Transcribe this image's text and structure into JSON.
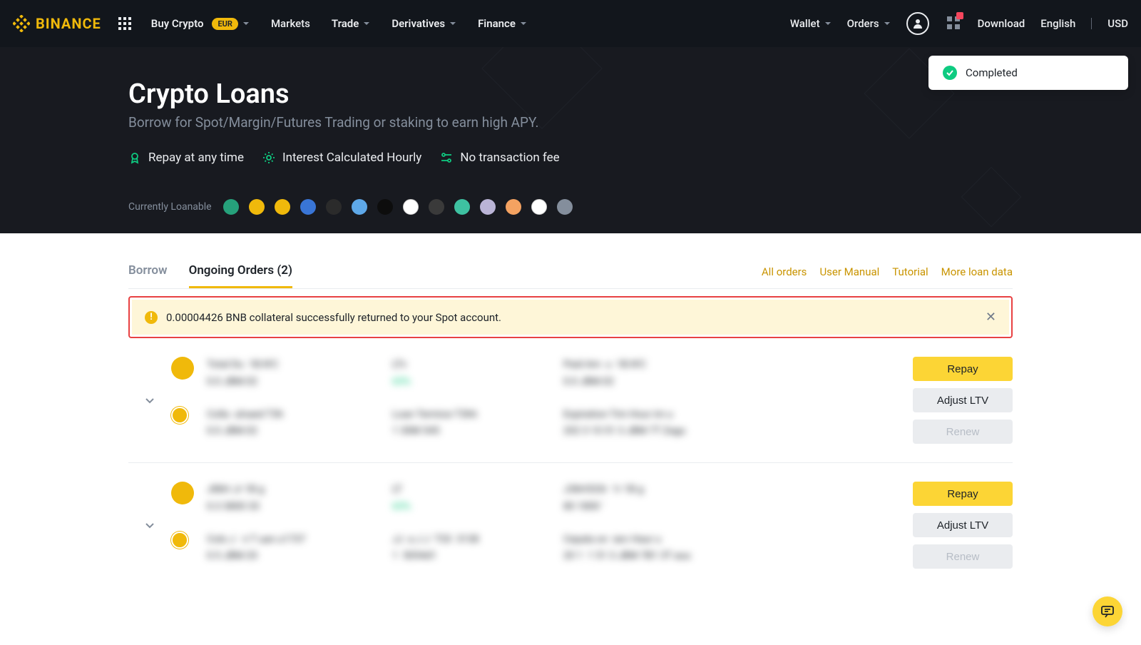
{
  "header": {
    "brand": "BINANCE",
    "nav": {
      "buy_crypto": "Buy Crypto",
      "buy_pill": "EUR",
      "markets": "Markets",
      "trade": "Trade",
      "derivatives": "Derivatives",
      "finance": "Finance"
    },
    "right": {
      "wallet": "Wallet",
      "orders": "Orders",
      "download": "Download",
      "lang": "English",
      "currency": "USD"
    }
  },
  "toast": {
    "text": "Completed"
  },
  "hero": {
    "title": "Crypto Loans",
    "subtitle": "Borrow for Spot/Margin/Futures Trading or staking to earn high APY.",
    "features": [
      "Repay at any time",
      "Interest Calculated Hourly",
      "No transaction fee"
    ],
    "loanable_label": "Currently Loanable",
    "loanable_coins": [
      {
        "bg": "#26a17b"
      },
      {
        "bg": "#f0b90b"
      },
      {
        "bg": "#f0b90b"
      },
      {
        "bg": "#3975d6"
      },
      {
        "bg": "#2b2b2b"
      },
      {
        "bg": "#5ea8e8"
      },
      {
        "bg": "#0d0d0d"
      },
      {
        "bg": "#ffffff",
        "border": "#ccc"
      },
      {
        "bg": "#3a3a3a"
      },
      {
        "bg": "#3ec1a1"
      },
      {
        "bg": "#bab4d6"
      },
      {
        "bg": "#f4a261"
      },
      {
        "bg": "#ffffff",
        "border": "#ccc"
      },
      {
        "bg": "#848e9c"
      }
    ]
  },
  "tabs": {
    "borrow": "Borrow",
    "ongoing": "Ongoing Orders (2)"
  },
  "links": {
    "all_orders": "All orders",
    "user_manual": "User Manual",
    "tutorial": "Tutorial",
    "more": "More loan data"
  },
  "alert": {
    "text": "0.00004426 BNB collateral successfully returned to your Spot account."
  },
  "orders": [
    {
      "asset_color": "#f0b90b",
      "sub_asset_color": "#f0b90b",
      "col1a": "Total Du  1B.N'C\n0.0 JBM.02",
      "col2a": "LTv\n65%",
      "col3a": "Paid Am  u  1B.N'C\n0.0 JBM.02",
      "col1b": "Colla  ulnaed T3h\n0.0 JBM.02",
      "col2b": "Loan Termice T3hh\n1 30M 545",
      "col3b": "Expiration Tim Hour im u\n202 3 10 51 3 JBM 7T Zagu"
    },
    {
      "asset_color": "#f0b90b",
      "sub_asset_color": "#f0b90b",
      "col1a": "J88rt Jr 1B g\n0.3 3800 33",
      "col2a": "LT\n65%",
      "col3a": "J38rt533r  1r 1B g\n80 1800 '",
      "col1b": "Colo J   n T uan u1737\n0.5 JBM.33",
      "col2b": "JJ  a J J  T33  3138\n1  5054d1",
      "col3b": "Cepala on  iarc Haur u\n20 1  1 51 3 JBM 7B1 3T auu"
    }
  ],
  "actions": {
    "repay": "Repay",
    "adjust": "Adjust LTV",
    "renew": "Renew"
  }
}
